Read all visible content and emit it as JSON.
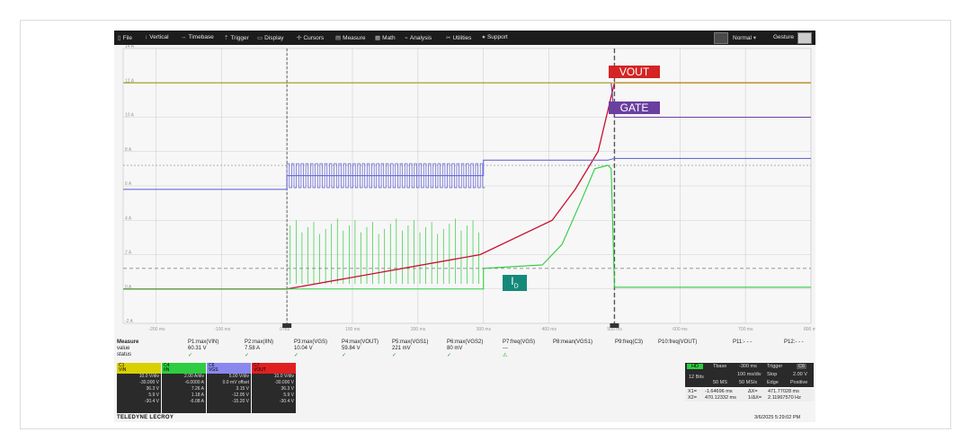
{
  "menu": {
    "items": [
      {
        "label": "File",
        "icon": "file-icon",
        "glyph": "▯"
      },
      {
        "label": "Vertical",
        "icon": "vertical-icon",
        "glyph": "↕"
      },
      {
        "label": "Timebase",
        "icon": "timebase-icon",
        "glyph": "↔"
      },
      {
        "label": "Trigger",
        "icon": "trigger-icon",
        "glyph": "⇡"
      },
      {
        "label": "Display",
        "icon": "display-icon",
        "glyph": "▭"
      },
      {
        "label": "Cursors",
        "icon": "cursors-icon",
        "glyph": "✢"
      },
      {
        "label": "Measure",
        "icon": "measure-icon",
        "glyph": "▤"
      },
      {
        "label": "Math",
        "icon": "math-icon",
        "glyph": "▦"
      },
      {
        "label": "Analysis",
        "icon": "analysis-icon",
        "glyph": "⌁"
      },
      {
        "label": "Utilities",
        "icon": "utilities-icon",
        "glyph": "✂"
      },
      {
        "label": "Support",
        "icon": "support-icon",
        "glyph": "●"
      }
    ],
    "mode": "Normal",
    "gesture": "Gesture"
  },
  "labels": {
    "vout": "VOUT",
    "gate": "GATE",
    "id_main": "I",
    "id_sub": "D"
  },
  "colors": {
    "vout": "#c8102e",
    "gate": "#6a3fa0",
    "vgs": "#6b6bd6",
    "id": "#2ecc40",
    "vin": "#b5b41a",
    "grid": "#cfcfcf",
    "marker": "#555555",
    "id_box": "#14897a"
  },
  "measure": {
    "title": "Measure",
    "row_value": "value",
    "row_status": "status",
    "params": [
      {
        "name": "P1:max(VIN)",
        "value": "60.31 V",
        "status": "✓"
      },
      {
        "name": "P2:max(IIN)",
        "value": "7.58 A",
        "status": "✓"
      },
      {
        "name": "P3:max(VGS)",
        "value": "10.04 V",
        "status": "✓"
      },
      {
        "name": "P4:max(VOUT)",
        "value": "59.84 V",
        "status": "✓"
      },
      {
        "name": "P5:max(VGS1)",
        "value": "221 mV",
        "status": "✓"
      },
      {
        "name": "P6:max(VGS2)",
        "value": "80 mV",
        "status": "✓"
      },
      {
        "name": "P7:freq(VGS)",
        "value": "---",
        "status": "⚠"
      },
      {
        "name": "P8:mean(VGS1)",
        "value": "",
        "status": ""
      },
      {
        "name": "P9:freq(C3)",
        "value": "",
        "status": ""
      },
      {
        "name": "P10:freq(VOUT)",
        "value": "",
        "status": ""
      },
      {
        "name": "P11:- - -",
        "value": "",
        "status": ""
      },
      {
        "name": "P12:- - -",
        "value": "",
        "status": ""
      }
    ]
  },
  "channels": [
    {
      "id": "C1",
      "name": "VIN",
      "color": "#d8d000",
      "vdiv": "10.0 V/div",
      "offset": "-30.000 V",
      "r1": "36.3 V",
      "r2": "5.9 V",
      "r3": "-30.4 V",
      "d": "Δ"
    },
    {
      "id": "C4",
      "name": "IIN",
      "color": "#2ecc40",
      "vdiv": "2.00 A/div",
      "offset": "-6.0000 A",
      "r1": "7.26 A",
      "r2": "1.18 A",
      "r3": "-6.08 A",
      "d": "Δ"
    },
    {
      "id": "C6",
      "name": "VGS",
      "color": "#8888ee",
      "vdiv": "5.00 V/div",
      "offset": "0.0 mV offset",
      "r1": "3.15 V",
      "r2": "-12.05 V",
      "r3": "-15.20 V",
      "d": "Δ"
    },
    {
      "id": "C7",
      "name": "VOUT",
      "color": "#e02020",
      "vdiv": "10.0 V/div",
      "offset": "-30.000 V",
      "r1": "36.3 V",
      "r2": "5.9 V",
      "r3": "-30.4 V",
      "d": "Δ"
    }
  ],
  "timebase": {
    "hd": "HD",
    "bits": "12 Bits",
    "tbase": "Tbase",
    "tbase_val": "-300 ms",
    "trigger": "Trigger",
    "trig_ch": "C6",
    "div": "100 ms/div",
    "stop": "Stop",
    "stop_val": "2.00 V",
    "samples": "50 MS",
    "rate": "50 MS/s",
    "edge": "Edge",
    "slope": "Positive"
  },
  "cursors": {
    "x1": "X1=",
    "x1v": "-1.64696 ms",
    "dx": "ΔX=",
    "dxv": "471.77028 ms",
    "x2": "X2=",
    "x2v": "470.12332 ms",
    "idx": "1/ΔX=",
    "idxv": "2.11967570 Hz"
  },
  "brand": "TELEDYNE LECROY",
  "timestamp": "3/6/2025 5:29:02 PM",
  "chart_data": {
    "type": "line",
    "x_ticks": [
      "-200 ms",
      "-100 ms",
      "0 ms",
      "100 ms",
      "200 ms",
      "300 ms",
      "400 ms",
      "500 ms",
      "600 ms",
      "700 ms",
      "800 ms"
    ],
    "y_ticks": [
      "14 A",
      "12 A",
      "10 A",
      "8 A",
      "6 A",
      "4 A",
      "2 A",
      "0 A",
      "-2 A"
    ],
    "xlim": [
      -250,
      800
    ],
    "ylim": [
      -2,
      14
    ],
    "grid": true,
    "series": [
      {
        "name": "VOUT",
        "x": [
          -250,
          0,
          295,
          405,
          440,
          475,
          500,
          800
        ],
        "y": [
          0,
          0,
          2,
          4,
          5.8,
          8,
          12,
          12
        ]
      },
      {
        "name": "GATE",
        "x": [
          -250,
          295,
          300,
          495,
          500,
          800
        ],
        "y": [
          12,
          12,
          12,
          12,
          10,
          10
        ]
      },
      {
        "name": "VGS",
        "x": [
          -250,
          0,
          0,
          300,
          300,
          490,
          500,
          800
        ],
        "y": [
          5.8,
          5.8,
          6.6,
          6.6,
          7.5,
          7.5,
          7.6,
          7.6
        ]
      },
      {
        "name": "ID",
        "x": [
          -250,
          0,
          300,
          300,
          390,
          420,
          450,
          470,
          490,
          495,
          500,
          800
        ],
        "y": [
          0,
          0,
          0,
          1.2,
          1.4,
          2.6,
          5.2,
          7,
          7.2,
          7.0,
          0.1,
          0.1
        ]
      },
      {
        "name": "VIN",
        "x": [
          -250,
          800
        ],
        "y": [
          12,
          12
        ]
      }
    ],
    "markers": [
      {
        "x": 0
      },
      {
        "x": 500
      }
    ]
  }
}
